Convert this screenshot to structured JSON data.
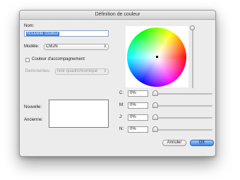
{
  "window": {
    "title": "Définition de couleur"
  },
  "form": {
    "name_label": "Nom:",
    "name_value": "Nouvelle couleur",
    "model_label": "Modèle:",
    "model_value": "CMJN",
    "spot_label": "Couleur d'accompagnement",
    "spot_checked": false,
    "halftone_label": "Demi-teintes:",
    "halftone_value": "Noir quadrichromique",
    "new_label": "Nouvelle:",
    "old_label": "Ancienne:"
  },
  "sliders": [
    {
      "label": "C:",
      "value": "0%",
      "level": 0
    },
    {
      "label": "M:",
      "value": "0%",
      "level": 0
    },
    {
      "label": "J:",
      "value": "0%",
      "level": 0
    },
    {
      "label": "N:",
      "value": "0%",
      "level": 0
    }
  ],
  "brightness_level": 1,
  "buttons": {
    "cancel": "Annuler",
    "ok": "OK"
  },
  "colors": {
    "ok_button": "#3b86e3",
    "selection": "#3d7ddc"
  }
}
